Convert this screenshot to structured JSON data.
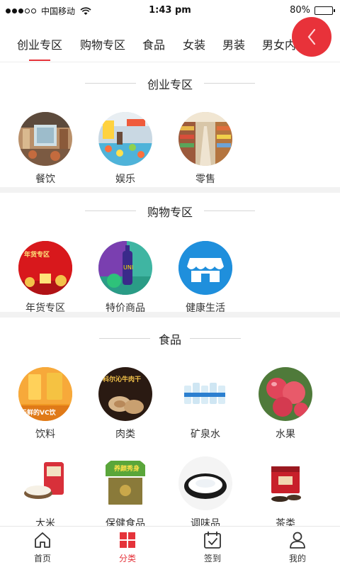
{
  "status": {
    "carrier": "中国移动",
    "time": "1:43 pm",
    "battery": "80%",
    "battery_level": 0.8
  },
  "tabs": [
    {
      "label": "创业专区",
      "active": true
    },
    {
      "label": "购物专区"
    },
    {
      "label": "食品"
    },
    {
      "label": "女装"
    },
    {
      "label": "男装"
    },
    {
      "label": "男女内"
    }
  ],
  "sections": [
    {
      "title": "创业专区",
      "items": [
        {
          "label": "餐饮",
          "image": "restaurant-photo"
        },
        {
          "label": "娱乐",
          "image": "playground-photo"
        },
        {
          "label": "零售",
          "image": "supermarket-photo"
        }
      ]
    },
    {
      "title": "购物专区",
      "items": [
        {
          "label": "年货专区",
          "image": "new-year-goods-photo",
          "image_text": "年货专区"
        },
        {
          "label": "特价商品",
          "image": "special-offer-photo"
        },
        {
          "label": "健康生活",
          "image": "shop-icon"
        }
      ]
    },
    {
      "title": "食品",
      "items": [
        {
          "label": "饮料",
          "image": "drinks-photo",
          "image_text": "天鲜的VC饮"
        },
        {
          "label": "肉类",
          "image": "meat-photo",
          "image_text": "科尔沁牛肉干"
        },
        {
          "label": "矿泉水",
          "image": "water-bottles-photo"
        },
        {
          "label": "水果",
          "image": "apples-photo"
        },
        {
          "label": "大米",
          "image": "rice-photo"
        },
        {
          "label": "保健食品",
          "image": "health-food-photo",
          "image_text": "养颜秀身"
        },
        {
          "label": "调味品",
          "image": "seasoning-photo"
        },
        {
          "label": "茶类",
          "image": "tea-photo"
        }
      ]
    }
  ],
  "nav": [
    {
      "label": "首页",
      "icon": "home-icon"
    },
    {
      "label": "分类",
      "icon": "category-icon",
      "active": true
    },
    {
      "label": "签到",
      "icon": "calendar-checkin-icon"
    },
    {
      "label": "我的",
      "icon": "profile-icon"
    }
  ],
  "colors": {
    "accent": "#e5333a",
    "back_button": "#e8323a",
    "section_separator": "#f2f2f2"
  }
}
